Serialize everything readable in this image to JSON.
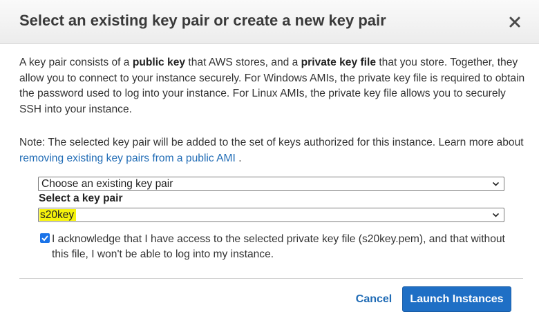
{
  "dialog": {
    "title": "Select an existing key pair or create a new key pair",
    "close_icon": "close-icon"
  },
  "intro": {
    "t1": "A key pair consists of a ",
    "b1": "public key",
    "t2": " that AWS stores, and a ",
    "b2": "private key file",
    "t3": " that you store. Together, they allow you to connect to your instance securely. For Windows AMIs, the private key file is required to obtain the password used to log into your instance. For Linux AMIs, the private key file allows you to securely SSH into your instance."
  },
  "note": {
    "text": "Note: The selected key pair will be added to the set of keys authorized for this instance. Learn more about ",
    "link": "removing existing key pairs from a public AMI",
    "end": " ."
  },
  "key_mode_select": {
    "value": "Choose an existing key pair"
  },
  "key_pair": {
    "label": "Select a key pair",
    "value": "s20key",
    "highlight_color": "#f5f20c"
  },
  "acknowledge": {
    "checked": true,
    "text": "I acknowledge that I have access to the selected private key file (s20key.pem), and that without this file, I won't be able to log into my instance."
  },
  "footer": {
    "cancel_label": "Cancel",
    "launch_label": "Launch Instances",
    "primary_color": "#1f6fc5",
    "link_color": "#1f6bb5"
  }
}
